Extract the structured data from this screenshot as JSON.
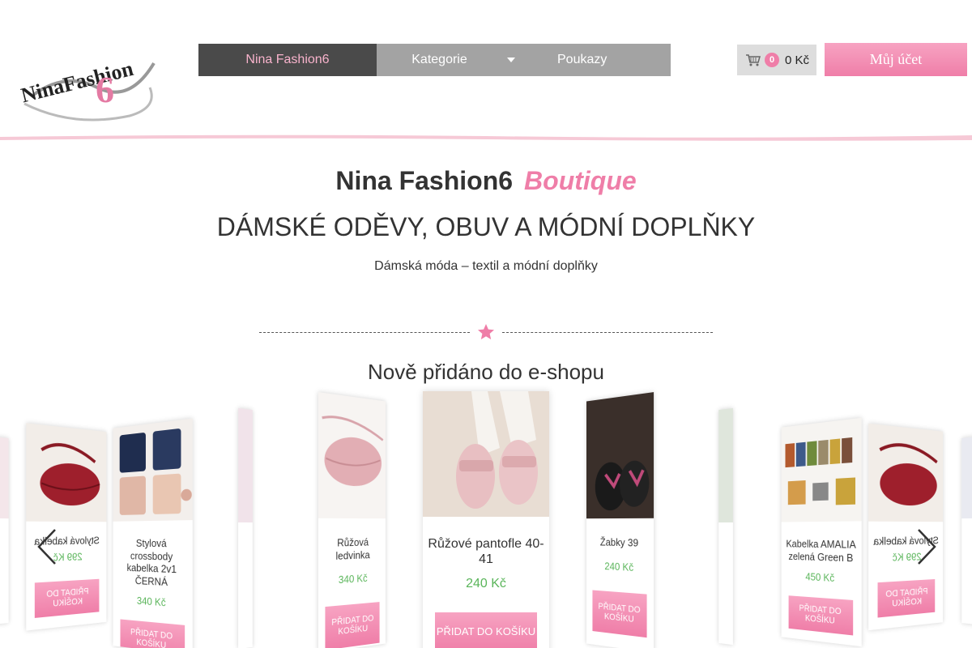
{
  "header": {
    "logo_text": "NinaFashion",
    "logo_number": "6",
    "nav": {
      "home": "Nina Fashion6",
      "categories": "Kategorie",
      "vouchers": "Poukazy"
    },
    "cart": {
      "count": "0",
      "total": "0 Kč"
    },
    "account_label": "Můj účet"
  },
  "hero": {
    "brand": "Nina Fashion6",
    "brand_accent": "Boutique",
    "subtitle": "DÁMSKÉ ODĚVY, OBUV A MÓDNÍ DOPLŇKY",
    "tagline": "Dámská móda – textil a módní doplňky"
  },
  "section_title": "Nově přidáno do e-shopu",
  "products": [
    {
      "title": "Stylová kabelka",
      "price": "299 Kč",
      "button": "PŘIDAT DO KOŠÍKU"
    },
    {
      "title": "Stylová crossbody kabelka 2v1 ČERNÁ",
      "price": "340 Kč",
      "button": "PŘIDAT DO KOŠÍKU"
    },
    {
      "title": "Růžová ledvinka",
      "price": "340 Kč",
      "button": "PŘIDAT DO KOŠÍKU"
    },
    {
      "title": "Růžové pantofle 40-41",
      "price": "240 Kč",
      "button": "PŘIDAT DO KOŠÍKU"
    },
    {
      "title": "Žabky 39",
      "price": "240 Kč",
      "button": "PŘIDAT DO KOŠÍKU"
    },
    {
      "title": "Kabelka AMALIA zelená Green B",
      "price": "450 Kč",
      "button": "PŘIDAT DO KOŠÍKU"
    },
    {
      "title": "Stylová kabelka",
      "price": "299 Kč",
      "button": "PŘIDAT DO KOŠÍKU"
    }
  ],
  "colors": {
    "accent_pink": "#ef7ea8",
    "price_green": "#5ab55a",
    "nav_gray": "#a3a3a3",
    "nav_dark": "#4a4a4a"
  },
  "icons": [
    "cart-icon",
    "star-icon",
    "chevron-left-icon",
    "chevron-right-icon",
    "caret-down-icon"
  ]
}
